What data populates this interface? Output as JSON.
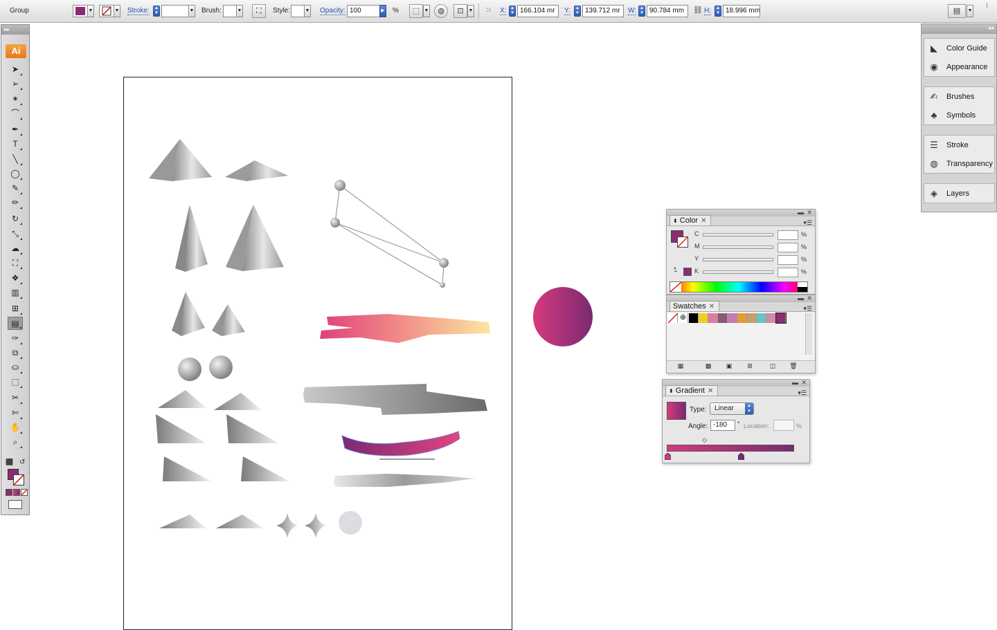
{
  "app": {
    "logo": "Ai"
  },
  "control_bar": {
    "selection_label": "Group",
    "fill_color": "#8e2a72",
    "stroke_label": "Stroke:",
    "brush_label": "Brush:",
    "style_label": "Style:",
    "opacity_label": "Opacity:",
    "opacity_value": "100",
    "percent": "%",
    "x_label": "X:",
    "x_value": "166.104 mr",
    "y_label": "Y:",
    "y_value": "139.712 mr",
    "w_label": "W:",
    "w_value": "90.784 mm",
    "h_label": "H:",
    "h_value": "18.996 mm"
  },
  "toolbox": {
    "tools": [
      {
        "name": "selection-tool",
        "glyph": "➤"
      },
      {
        "name": "direct-selection-tool",
        "glyph": "➢"
      },
      {
        "name": "magic-wand-tool",
        "glyph": "✶"
      },
      {
        "name": "lasso-tool",
        "glyph": "⌒"
      },
      {
        "name": "pen-tool",
        "glyph": "✒"
      },
      {
        "name": "type-tool",
        "glyph": "T"
      },
      {
        "name": "line-tool",
        "glyph": "╲"
      },
      {
        "name": "ellipse-tool",
        "glyph": "◯"
      },
      {
        "name": "paintbrush-tool",
        "glyph": "✎"
      },
      {
        "name": "pencil-tool",
        "glyph": "✏"
      },
      {
        "name": "rotate-tool",
        "glyph": "↻"
      },
      {
        "name": "scale-tool",
        "glyph": "⤡"
      },
      {
        "name": "warp-tool",
        "glyph": "☁"
      },
      {
        "name": "free-transform-tool",
        "glyph": "⛶"
      },
      {
        "name": "symbol-sprayer-tool",
        "glyph": "❖"
      },
      {
        "name": "column-graph-tool",
        "glyph": "▥"
      },
      {
        "name": "mesh-tool",
        "glyph": "⊞"
      },
      {
        "name": "gradient-tool",
        "glyph": "▤"
      },
      {
        "name": "eyedropper-tool",
        "glyph": "✑"
      },
      {
        "name": "blend-tool",
        "glyph": "⧉"
      },
      {
        "name": "live-paint-bucket-tool",
        "glyph": "⛀"
      },
      {
        "name": "live-paint-selection-tool",
        "glyph": "⬚"
      },
      {
        "name": "slice-tool",
        "glyph": "✂"
      },
      {
        "name": "scissors-tool",
        "glyph": "✄"
      },
      {
        "name": "hand-tool",
        "glyph": "✋"
      },
      {
        "name": "zoom-tool",
        "glyph": "⌕"
      }
    ]
  },
  "dock": {
    "groups": [
      {
        "items": [
          {
            "label": "Color Guide",
            "icon": "◣"
          },
          {
            "label": "Appearance",
            "icon": "◉"
          }
        ]
      },
      {
        "items": [
          {
            "label": "Brushes",
            "icon": "✍"
          },
          {
            "label": "Symbols",
            "icon": "♣"
          }
        ]
      },
      {
        "items": [
          {
            "label": "Stroke",
            "icon": "☰"
          },
          {
            "label": "Transparency",
            "icon": "◍"
          }
        ]
      },
      {
        "items": [
          {
            "label": "Layers",
            "icon": "◈"
          }
        ]
      }
    ]
  },
  "color_panel": {
    "tab": "Color",
    "sliders": [
      {
        "label": "C"
      },
      {
        "label": "M"
      },
      {
        "label": "Y"
      },
      {
        "label": "K"
      }
    ],
    "percent": "%"
  },
  "swatches_panel": {
    "tab": "Swatches",
    "swatches": [
      "#ffffff",
      "#ffffff",
      "#000000",
      "#e8d21e",
      "#e07aa4",
      "#8a5a6e",
      "#c87bb0",
      "#e49a3a",
      "#c5a06a",
      "#6ec0c8",
      "#d48aa6",
      "#8e2a72"
    ]
  },
  "gradient_panel": {
    "tab": "Gradient",
    "type_label": "Type:",
    "type_value": "Linear",
    "angle_label": "Angle:",
    "angle_value": "-180",
    "degree": "°",
    "location_label": "Location:",
    "percent": "%",
    "start_color": "#d63a7c",
    "end_color": "#7a2a72"
  }
}
